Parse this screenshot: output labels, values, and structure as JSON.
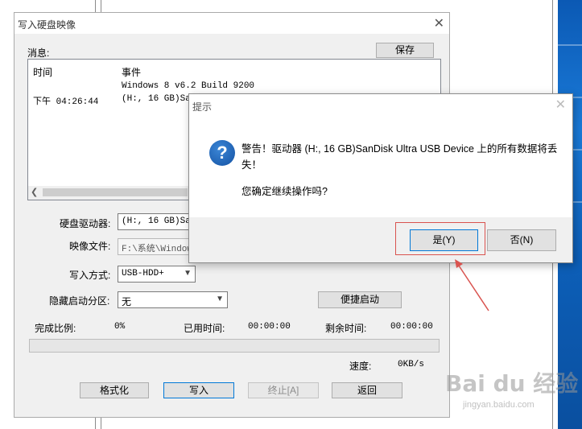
{
  "main_window": {
    "title": "写入硬盘映像",
    "close_glyph": "✕",
    "messages_label": "消息:",
    "save_button": "保存",
    "log": {
      "columns": [
        "时间",
        "事件"
      ],
      "lines": [
        {
          "time": "",
          "event": "Windows 8 v6.2 Build 9200"
        },
        {
          "time": "下午 04:26:44",
          "event": "(H:, 16 GB)Sa"
        }
      ]
    },
    "disk_drive_label": "硬盘驱动器:",
    "disk_drive_value": "(H:, 16 GB)San",
    "image_file_label": "映像文件:",
    "image_file_value": "F:\\系统\\Window",
    "write_method_label": "写入方式:",
    "write_method_value": "USB-HDD+",
    "hidden_partition_label": "隐藏启动分区:",
    "hidden_partition_value": "无",
    "quick_boot_button": "便捷启动",
    "progress_label": "完成比例:",
    "progress_value": "0%",
    "progress_fraction": 0,
    "elapsed_label": "已用时间:",
    "elapsed_value": "00:00:00",
    "remaining_label": "剩余时间:",
    "remaining_value": "00:00:00",
    "speed_label": "速度:",
    "speed_value": "0KB/s",
    "buttons": {
      "format": "格式化",
      "write": "写入",
      "stop": "终止[A]",
      "back": "返回"
    }
  },
  "prompt_dialog": {
    "title": "提示",
    "close_glyph": "✕",
    "icon_glyph": "?",
    "message": "警告！驱动器 (H:, 16 GB)SanDisk Ultra USB Device 上的所有数据将丢失！",
    "question": "您确定继续操作吗?",
    "yes_button": "是(Y)",
    "no_button": "否(N)"
  },
  "watermark": {
    "brand": "Bai du 经验",
    "url": "jingyan.baidu.com"
  },
  "colors": {
    "annotation_red": "#d9534f",
    "focus_blue": "#0078d7",
    "desktop_blue": "#1a7ad8"
  }
}
